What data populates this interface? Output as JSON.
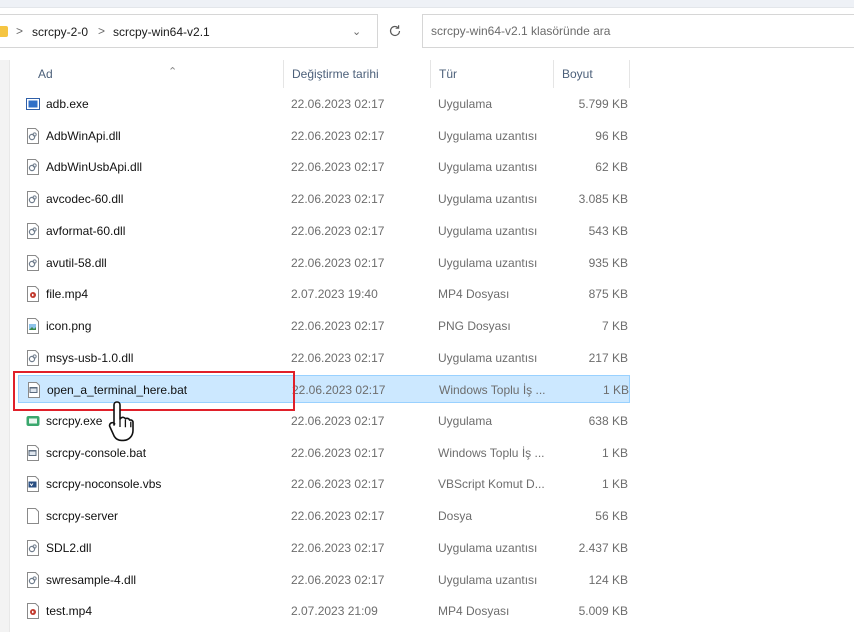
{
  "address_bar": {
    "breadcrumbs": [
      "scrcpy-2-0",
      "scrcpy-win64-v2.1"
    ],
    "separator": ">"
  },
  "search": {
    "placeholder": "scrcpy-win64-v2.1 klasöründe ara"
  },
  "columns": {
    "name": "Ad",
    "date": "Değiştirme tarihi",
    "type": "Tür",
    "size": "Boyut"
  },
  "files": [
    {
      "name": "adb.exe",
      "date": "22.06.2023 02:17",
      "type": "Uygulama",
      "size": "5.799 KB",
      "icon": "adb-exe-icon"
    },
    {
      "name": "AdbWinApi.dll",
      "date": "22.06.2023 02:17",
      "type": "Uygulama uzantısı",
      "size": "96 KB",
      "icon": "dll-icon"
    },
    {
      "name": "AdbWinUsbApi.dll",
      "date": "22.06.2023 02:17",
      "type": "Uygulama uzantısı",
      "size": "62 KB",
      "icon": "dll-icon"
    },
    {
      "name": "avcodec-60.dll",
      "date": "22.06.2023 02:17",
      "type": "Uygulama uzantısı",
      "size": "3.085 KB",
      "icon": "dll-icon"
    },
    {
      "name": "avformat-60.dll",
      "date": "22.06.2023 02:17",
      "type": "Uygulama uzantısı",
      "size": "543 KB",
      "icon": "dll-icon"
    },
    {
      "name": "avutil-58.dll",
      "date": "22.06.2023 02:17",
      "type": "Uygulama uzantısı",
      "size": "935 KB",
      "icon": "dll-icon"
    },
    {
      "name": "file.mp4",
      "date": "2.07.2023 19:40",
      "type": "MP4 Dosyası",
      "size": "875 KB",
      "icon": "video-file-icon"
    },
    {
      "name": "icon.png",
      "date": "22.06.2023 02:17",
      "type": "PNG Dosyası",
      "size": "7 KB",
      "icon": "image-file-icon"
    },
    {
      "name": "msys-usb-1.0.dll",
      "date": "22.06.2023 02:17",
      "type": "Uygulama uzantısı",
      "size": "217 KB",
      "icon": "dll-icon"
    },
    {
      "name": "open_a_terminal_here.bat",
      "date": "22.06.2023 02:17",
      "type": "Windows Toplu İş ...",
      "size": "1 KB",
      "icon": "batch-file-icon",
      "selected": true
    },
    {
      "name": "scrcpy.exe",
      "date": "22.06.2023 02:17",
      "type": "Uygulama",
      "size": "638 KB",
      "icon": "scrcpy-exe-icon"
    },
    {
      "name": "scrcpy-console.bat",
      "date": "22.06.2023 02:17",
      "type": "Windows Toplu İş ...",
      "size": "1 KB",
      "icon": "batch-file-icon"
    },
    {
      "name": "scrcpy-noconsole.vbs",
      "date": "22.06.2023 02:17",
      "type": "VBScript Komut D...",
      "size": "1 KB",
      "icon": "vbscript-file-icon"
    },
    {
      "name": "scrcpy-server",
      "date": "22.06.2023 02:17",
      "type": "Dosya",
      "size": "56 KB",
      "icon": "blank-file-icon"
    },
    {
      "name": "SDL2.dll",
      "date": "22.06.2023 02:17",
      "type": "Uygulama uzantısı",
      "size": "2.437 KB",
      "icon": "dll-icon"
    },
    {
      "name": "swresample-4.dll",
      "date": "22.06.2023 02:17",
      "type": "Uygulama uzantısı",
      "size": "124 KB",
      "icon": "dll-icon"
    },
    {
      "name": "test.mp4",
      "date": "2.07.2023 21:09",
      "type": "MP4 Dosyası",
      "size": "5.009 KB",
      "icon": "video-file-icon"
    }
  ],
  "colors": {
    "selection_bg": "#cce8ff",
    "selection_border": "#99d1ff",
    "highlight_box": "#e0202a",
    "header_text": "#4c607a"
  }
}
